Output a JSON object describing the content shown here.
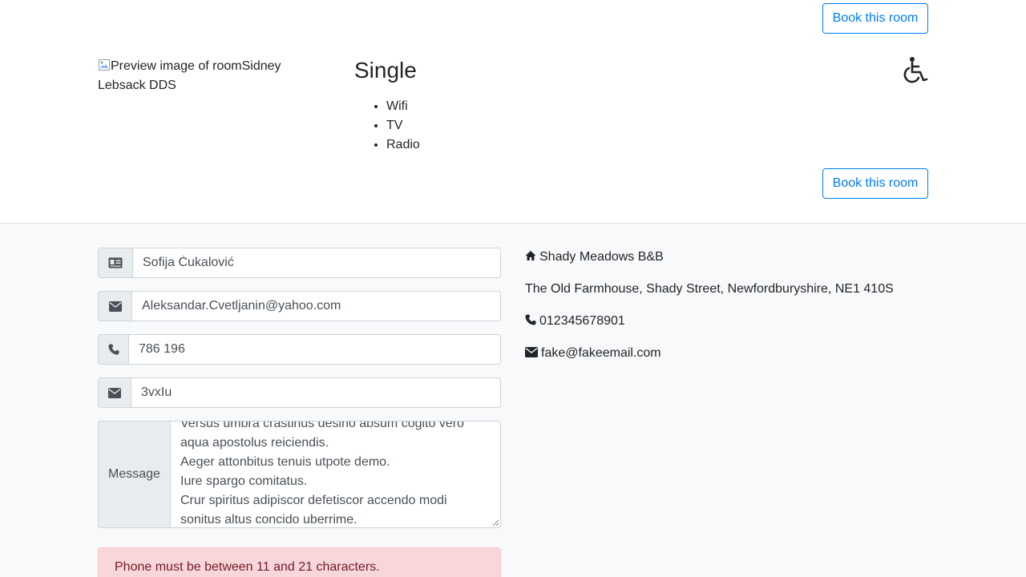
{
  "room": {
    "book_label": "Book this room",
    "image_alt": "Preview image of roomSidney Lebsack DDS",
    "type": "Single",
    "features": [
      "Wifi",
      "TV",
      "Radio"
    ],
    "accessible_icon": "wheelchair-icon"
  },
  "form": {
    "name": {
      "icon": "id-card-icon",
      "value": "Sofija Ćukalović"
    },
    "email": {
      "icon": "envelope-icon",
      "value": "Aleksandar.Cvetljanin@yahoo.com"
    },
    "phone": {
      "icon": "phone-icon",
      "value": "786 196"
    },
    "subject": {
      "icon": "envelope-icon",
      "value": "3vxIu"
    },
    "message": {
      "label": "Message",
      "value": "Versus umbra crastinus desino absum cogito vero aqua apostolus reiciendis.\nAeger attonbitus tenuis utpote demo.\nIure spargo comitatus.\nCrur spiritus adipiscor defetiscor accendo modi sonitus altus concido uberrime."
    },
    "error": "Phone must be between 11 and 21 characters."
  },
  "contact": {
    "name": "Shady Meadows B&B",
    "address": "The Old Farmhouse, Shady Street, Newfordburyshire, NE1 410S",
    "phone": "012345678901",
    "email": "fake@fakeemail.com"
  },
  "colors": {
    "primary": "#007bff",
    "alert_bg": "#f8d7da",
    "alert_text": "#721c24",
    "page_bg": "#f8f9fa"
  }
}
